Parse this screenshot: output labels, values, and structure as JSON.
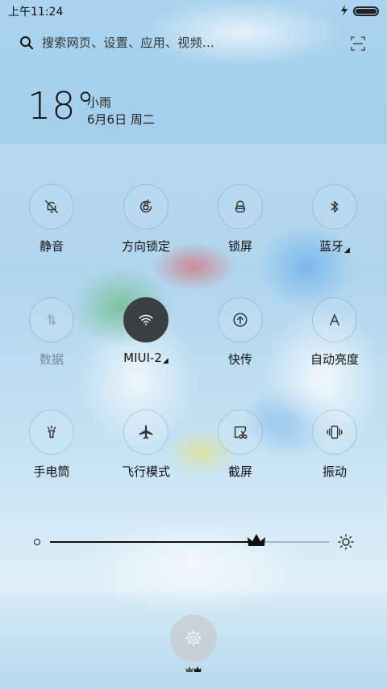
{
  "status_bar": {
    "time": "上午11:24",
    "battery_level": 1.0
  },
  "search": {
    "placeholder": "搜索网页、设置、应用、视频..."
  },
  "weather": {
    "temperature": "18°",
    "condition": "小雨",
    "date": "6月6日 周二"
  },
  "toggles": [
    {
      "label": "静音",
      "icon": "bell-off-icon",
      "state": "off"
    },
    {
      "label": "方向锁定",
      "icon": "rotation-lock-icon",
      "state": "off"
    },
    {
      "label": "锁屏",
      "icon": "lock-icon",
      "state": "off"
    },
    {
      "label": "蓝牙",
      "icon": "bluetooth-icon",
      "state": "off",
      "has_menu": true
    },
    {
      "label": "数据",
      "icon": "mobile-data-icon",
      "state": "disabled"
    },
    {
      "label": "MIUI-2",
      "icon": "wifi-icon",
      "state": "on",
      "has_menu": true
    },
    {
      "label": "快传",
      "icon": "quick-transfer-icon",
      "state": "off"
    },
    {
      "label": "自动亮度",
      "icon": "auto-brightness-icon",
      "state": "off"
    },
    {
      "label": "手电筒",
      "icon": "flashlight-icon",
      "state": "off"
    },
    {
      "label": "飞行模式",
      "icon": "airplane-icon",
      "state": "off"
    },
    {
      "label": "截屏",
      "icon": "screenshot-icon",
      "state": "off"
    },
    {
      "label": "振动",
      "icon": "vibrate-icon",
      "state": "off"
    }
  ],
  "brightness": {
    "level": 0.74
  },
  "bottom": {
    "settings_icon": "gear-icon",
    "page_indicator": "crown-icons"
  },
  "colors": {
    "active_tile": "#3c3f41",
    "text": "#111111",
    "dim_text": "#7a8a96"
  }
}
